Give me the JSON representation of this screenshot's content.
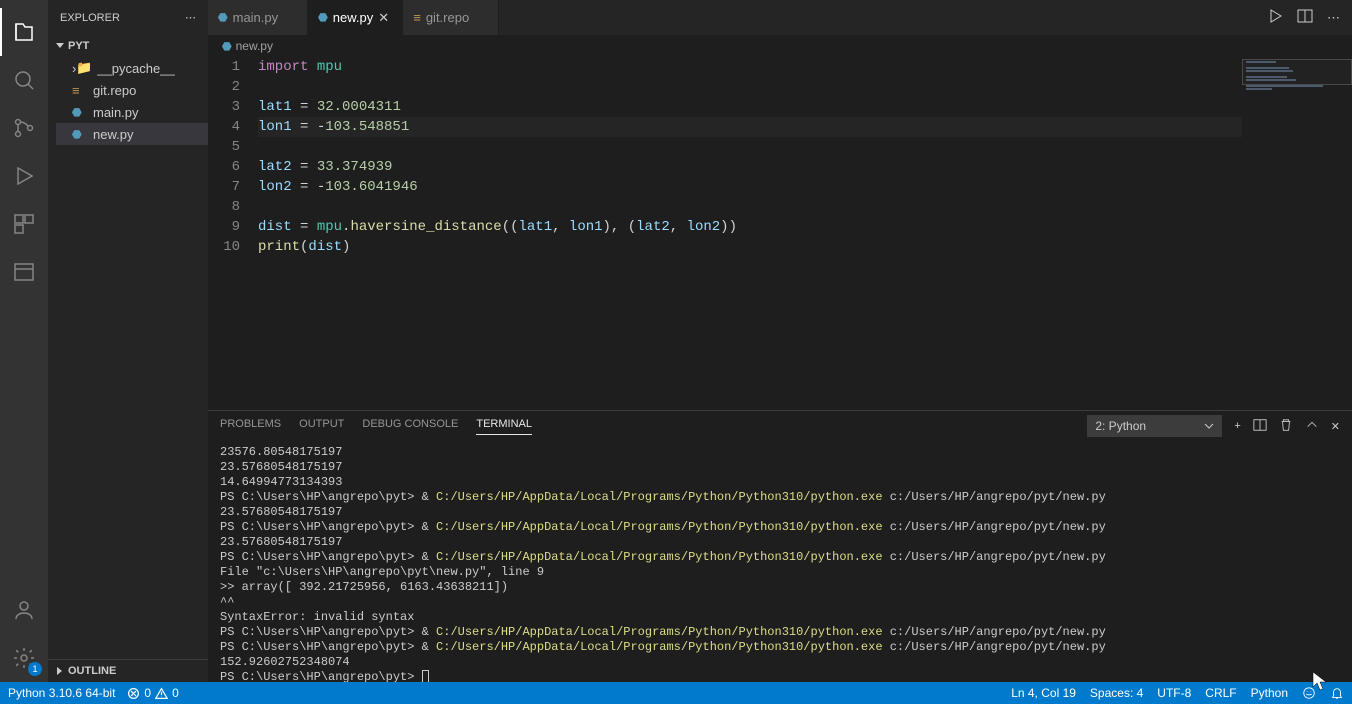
{
  "sidebar": {
    "title": "EXPLORER",
    "project": "PYT",
    "items": [
      {
        "name": "__pycache__",
        "type": "folder"
      },
      {
        "name": "git.repo",
        "type": "file"
      },
      {
        "name": "main.py",
        "type": "python"
      },
      {
        "name": "new.py",
        "type": "python",
        "active": true
      }
    ],
    "outline": "OUTLINE",
    "settings_badge": "1"
  },
  "tabs": [
    {
      "label": "main.py",
      "type": "python"
    },
    {
      "label": "new.py",
      "type": "python",
      "active": true,
      "closable": true
    },
    {
      "label": "git.repo",
      "type": "file"
    }
  ],
  "breadcrumb": {
    "file": "new.py"
  },
  "editor": {
    "lines": [
      {
        "n": 1,
        "html": "<span class='tk-keyword'>import</span> <span class='tk-module'>mpu</span>"
      },
      {
        "n": 2,
        "html": ""
      },
      {
        "n": 3,
        "html": "<span class='tk-var'>lat1</span> = <span class='tk-num'>32.0004311</span>"
      },
      {
        "n": 4,
        "html": "<span class='tk-var'>lon1</span> = -<span class='tk-num'>103.548851</span>",
        "highlight": true
      },
      {
        "n": 5,
        "html": ""
      },
      {
        "n": 6,
        "html": "<span class='tk-var'>lat2</span> = <span class='tk-num'>33.374939</span>"
      },
      {
        "n": 7,
        "html": "<span class='tk-var'>lon2</span> = -<span class='tk-num'>103.6041946</span>"
      },
      {
        "n": 8,
        "html": ""
      },
      {
        "n": 9,
        "html": "<span class='tk-var'>dist</span> = <span class='tk-module'>mpu</span>.<span class='tk-func'>haversine_distance</span>((<span class='tk-var'>lat1</span>, <span class='tk-var'>lon1</span>), (<span class='tk-var'>lat2</span>, <span class='tk-var'>lon2</span>))"
      },
      {
        "n": 10,
        "html": "<span class='tk-func'>print</span>(<span class='tk-var'>dist</span>)"
      }
    ]
  },
  "panel": {
    "tabs": [
      "PROBLEMS",
      "OUTPUT",
      "DEBUG CONSOLE",
      "TERMINAL"
    ],
    "active_tab": "TERMINAL",
    "dropdown": "2: Python",
    "lines": [
      {
        "text": "23576.80548175197"
      },
      {
        "text": "23.57680548175197"
      },
      {
        "text": "14.64994773134393"
      },
      {
        "prompt": "PS C:\\Users\\HP\\angrepo\\pyt> & ",
        "exec": "C:/Users/HP/AppData/Local/Programs/Python/Python310/python.exe",
        "arg": " c:/Users/HP/angrepo/pyt/new.py"
      },
      {
        "text": "23.57680548175197"
      },
      {
        "prompt": "PS C:\\Users\\HP\\angrepo\\pyt> & ",
        "exec": "C:/Users/HP/AppData/Local/Programs/Python/Python310/python.exe",
        "arg": " c:/Users/HP/angrepo/pyt/new.py"
      },
      {
        "text": "23.57680548175197"
      },
      {
        "prompt": "PS C:\\Users\\HP\\angrepo\\pyt> & ",
        "exec": "C:/Users/HP/AppData/Local/Programs/Python/Python310/python.exe",
        "arg": " c:/Users/HP/angrepo/pyt/new.py"
      },
      {
        "text": "  File \"c:\\Users\\HP\\angrepo\\pyt\\new.py\", line 9"
      },
      {
        "text": "    >> array([ 392.21725956, 6163.43638211])"
      },
      {
        "text": "    ^^"
      },
      {
        "text": "SyntaxError: invalid syntax"
      },
      {
        "prompt": "PS C:\\Users\\HP\\angrepo\\pyt> & ",
        "exec": "C:/Users/HP/AppData/Local/Programs/Python/Python310/python.exe",
        "arg": " c:/Users/HP/angrepo/pyt/new.py"
      },
      {
        "prompt": "PS C:\\Users\\HP\\angrepo\\pyt> & ",
        "exec": "C:/Users/HP/AppData/Local/Programs/Python/Python310/python.exe",
        "arg": " c:/Users/HP/angrepo/pyt/new.py"
      },
      {
        "text": "152.92602752348074"
      },
      {
        "prompt": "PS C:\\Users\\HP\\angrepo\\pyt> ",
        "cursor": true
      }
    ]
  },
  "status": {
    "python": "Python 3.10.6 64-bit",
    "errors": "0",
    "warnings": "0",
    "cursor": "Ln 4, Col 19",
    "spaces": "Spaces: 4",
    "encoding": "UTF-8",
    "eol": "CRLF",
    "lang": "Python"
  }
}
